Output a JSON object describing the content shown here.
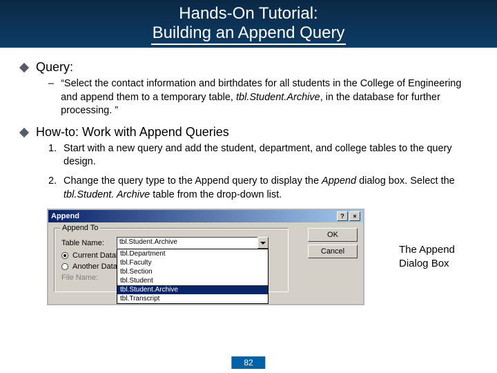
{
  "header": {
    "line1": "Hands-On Tutorial:",
    "line2": "Building an Append Query"
  },
  "section1": {
    "heading": "Query:",
    "dash_text": "“Select the contact information and birthdates for all students in the College of Engineering and append them to a temporary table, ",
    "dash_italic": "tbl.Student.Archive",
    "dash_tail": ", in the database for further processing. ”"
  },
  "section2": {
    "heading": "How-to: Work with Append Queries",
    "step1": "Start with a new query and add the student, department, and college tables to the query design.",
    "step2_a": "Change the query type to the Append query to display the ",
    "step2_i1": "Append",
    "step2_b": " dialog box. Select the ",
    "step2_i2": "tbl.Student. Archive",
    "step2_c": " table from the drop-down list."
  },
  "dialog": {
    "title": "Append",
    "help_btn": "?",
    "close_btn": "×",
    "group_label": "Append To",
    "table_label": "Table Name:",
    "selected_value": "tbl.Student.Archive",
    "options": [
      "tbl.Department",
      "tbl.Faculty",
      "tbl.Section",
      "tbl.Student",
      "tbl.Student.Archive",
      "tbl.Transcript"
    ],
    "radio_current": "Current Database",
    "radio_another": "Another Database:",
    "filename_label": "File Name:",
    "ok": "OK",
    "cancel": "Cancel"
  },
  "caption": {
    "line1": "The Append",
    "line2": "Dialog Box"
  },
  "page_number": "82"
}
